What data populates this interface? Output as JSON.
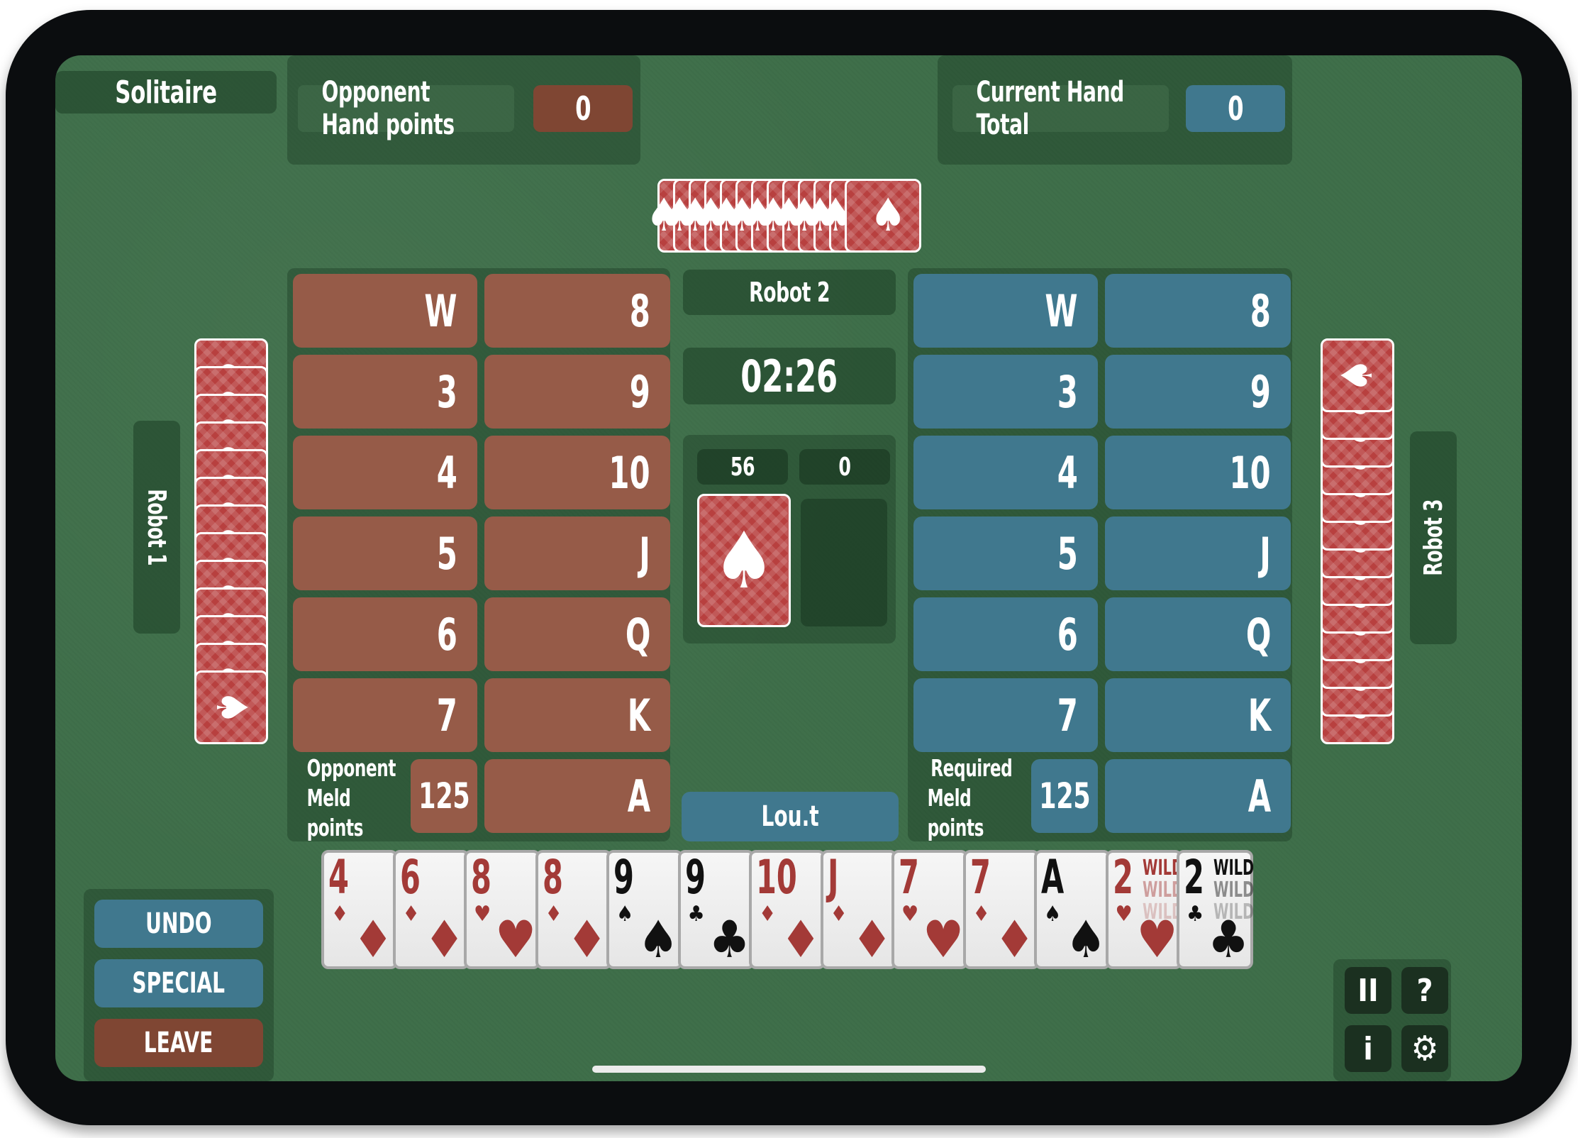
{
  "header": {
    "mode_label": "Solitaire",
    "opponent_hand_points": {
      "label": "Opponent Hand points",
      "value": "0"
    },
    "current_hand_total": {
      "label": "Current Hand Total",
      "value": "0"
    }
  },
  "players": {
    "top": {
      "name": "Robot 2",
      "card_count": 13
    },
    "left": {
      "name": "Robot 1",
      "card_count": 13
    },
    "right": {
      "name": "Robot 3",
      "card_count": 13
    },
    "bottom": {
      "name": "Lou.t"
    }
  },
  "timer": "02:26",
  "deck": {
    "stock_count": "56",
    "discard_count": "0"
  },
  "opponent_melds": {
    "cells": [
      [
        "W",
        "8"
      ],
      [
        "3",
        "9"
      ],
      [
        "4",
        "10"
      ],
      [
        "5",
        "J"
      ],
      [
        "6",
        "Q"
      ],
      [
        "7",
        "K"
      ]
    ],
    "last_cell": "A",
    "meld_label_line1": "Opponent",
    "meld_label_line2": "Meld points",
    "meld_points": "125"
  },
  "team_melds": {
    "cells": [
      [
        "W",
        "8"
      ],
      [
        "3",
        "9"
      ],
      [
        "4",
        "10"
      ],
      [
        "5",
        "J"
      ],
      [
        "6",
        "Q"
      ],
      [
        "7",
        "K"
      ]
    ],
    "last_cell": "A",
    "meld_label_line1": "Required",
    "meld_label_line2": "Meld points",
    "meld_points": "125"
  },
  "hand": [
    {
      "rank": "4",
      "suit": "♦",
      "color": "red"
    },
    {
      "rank": "6",
      "suit": "♦",
      "color": "red"
    },
    {
      "rank": "8",
      "suit": "♥",
      "color": "red"
    },
    {
      "rank": "8",
      "suit": "♦",
      "color": "red"
    },
    {
      "rank": "9",
      "suit": "♠",
      "color": "black"
    },
    {
      "rank": "9",
      "suit": "♣",
      "color": "black"
    },
    {
      "rank": "10",
      "suit": "♦",
      "color": "red"
    },
    {
      "rank": "J",
      "suit": "♦",
      "color": "red"
    },
    {
      "rank": "7",
      "suit": "♥",
      "color": "red"
    },
    {
      "rank": "7",
      "suit": "♦",
      "color": "red"
    },
    {
      "rank": "A",
      "suit": "♠",
      "color": "black"
    },
    {
      "rank": "2",
      "suit": "♥",
      "color": "red",
      "wild": "WILD"
    },
    {
      "rank": "2",
      "suit": "♣",
      "color": "black",
      "wild": "WILD"
    }
  ],
  "actions": {
    "undo": "UNDO",
    "special": "SPECIAL",
    "leave": "LEAVE"
  },
  "controls": {
    "pause": "II",
    "help": "?",
    "info": "i",
    "settings": "⚙"
  },
  "icons": {
    "card_back": "spade-emblem"
  },
  "colors": {
    "opponent": "#965b48",
    "team": "#40788e",
    "felt": "#3f6f4a",
    "card_back": "#b8403f"
  }
}
